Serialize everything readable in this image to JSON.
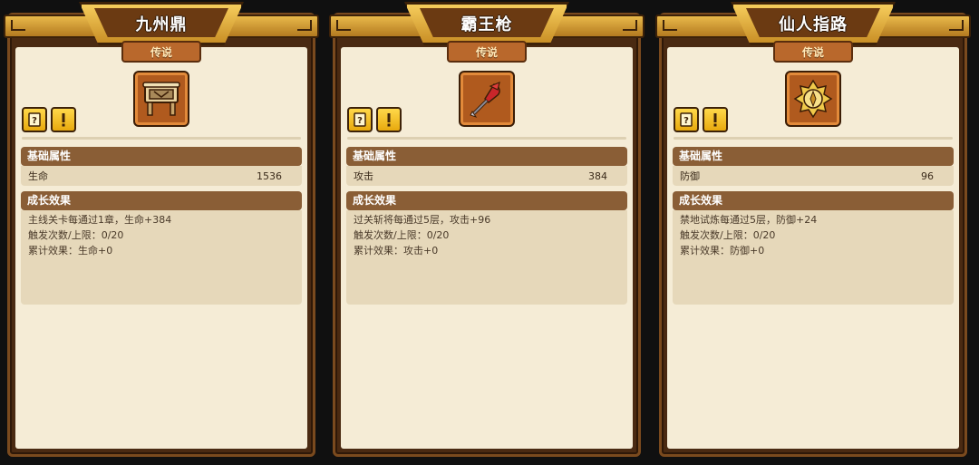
{
  "cards": [
    {
      "title": "九州鼎",
      "rarity": "传说",
      "item_icon": "cauldron-icon",
      "base_header": "基础属性",
      "base_attr": {
        "name": "生命",
        "value": "1536"
      },
      "growth_header": "成长效果",
      "growth_lines": [
        "主线关卡每通过1章，生命+384",
        "触发次数/上限：0/20",
        "累计效果：生命+0"
      ]
    },
    {
      "title": "霸王枪",
      "rarity": "传说",
      "item_icon": "spear-icon",
      "base_header": "基础属性",
      "base_attr": {
        "name": "攻击",
        "value": "384"
      },
      "growth_header": "成长效果",
      "growth_lines": [
        "过关斩将每通过5层，攻击+96",
        "触发次数/上限：0/20",
        "累计效果：攻击+0"
      ]
    },
    {
      "title": "仙人指路",
      "rarity": "传说",
      "item_icon": "compass-icon",
      "base_header": "基础属性",
      "base_attr": {
        "name": "防御",
        "value": "96"
      },
      "growth_header": "成长效果",
      "growth_lines": [
        "禁地试炼每通过5层，防御+24",
        "触发次数/上限：0/20",
        "累计效果：防御+0"
      ]
    }
  ],
  "colors": {
    "gold": "#f6cd5c",
    "paper": "#f5ecd6",
    "header_brown": "#8a5e36",
    "frame": "#4a2a12"
  }
}
